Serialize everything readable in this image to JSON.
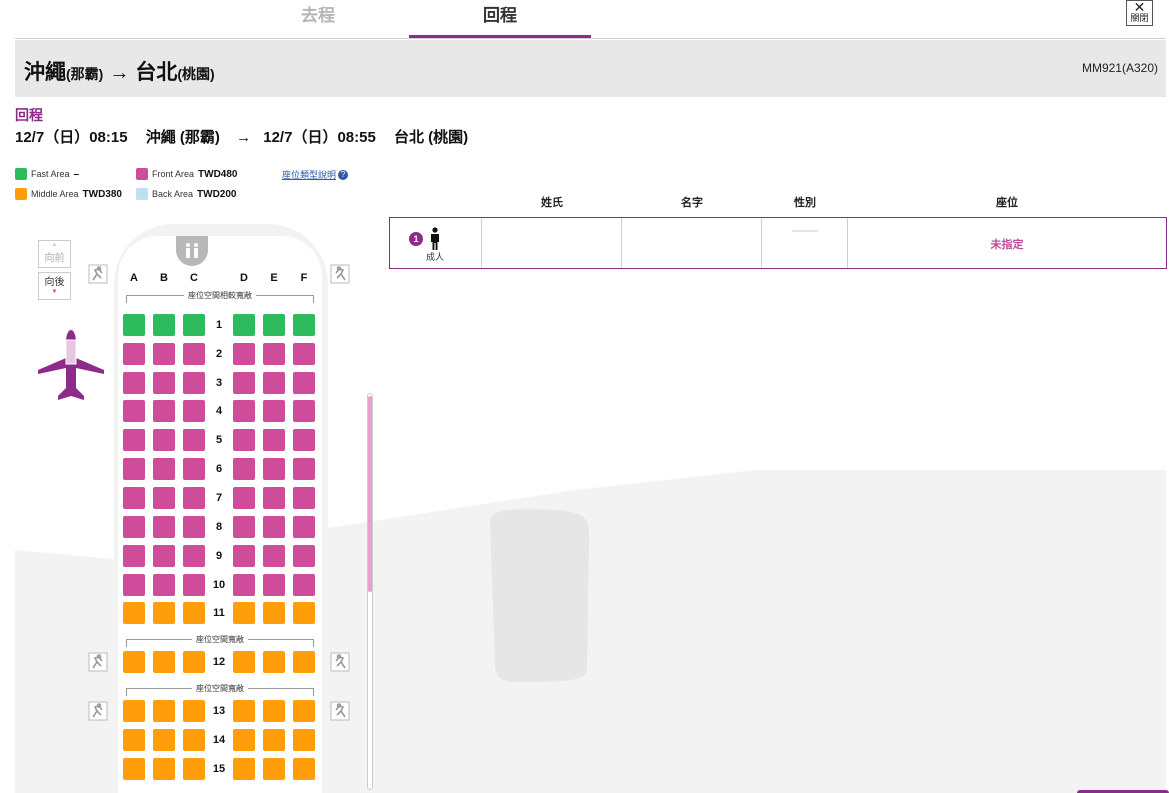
{
  "tabs": {
    "outbound": "去程",
    "return": "回程"
  },
  "close": {
    "label": "關閉"
  },
  "route": {
    "from_city": "沖繩",
    "from_airport": "(那霸)",
    "arrow": "→",
    "to_city": "台北",
    "to_airport": "(桃園)",
    "flight_no": "MM921(A320)"
  },
  "segment": {
    "label": "回程",
    "dep_datetime": "12/7（日）08:15",
    "dep_place": "沖繩 (那霸)",
    "arrow": "→",
    "arr_datetime": "12/7（日）08:55",
    "arr_place": "台北 (桃園)"
  },
  "legend": {
    "fast": {
      "name": "Fast Area",
      "price": "–",
      "color": "#2dbb5e"
    },
    "front": {
      "name": "Front Area",
      "price": "TWD480",
      "color": "#cf4c9a"
    },
    "middle": {
      "name": "Middle Area",
      "price": "TWD380",
      "color": "#ff9d0a"
    },
    "back": {
      "name": "Back Area",
      "price": "TWD200",
      "color": "#bfe0f0"
    },
    "help_link": "座位類型說明"
  },
  "seatmap": {
    "front_label": "向前",
    "back_label": "向後",
    "columns": [
      "A",
      "B",
      "C",
      "D",
      "E",
      "F"
    ],
    "space_note_1": "座位空間相較寬敞",
    "space_note_2": "座位空間寬敞",
    "space_note_3": "座位空間寬敞",
    "rows": [
      {
        "num": "1",
        "area": "fast"
      },
      {
        "num": "2",
        "area": "front"
      },
      {
        "num": "3",
        "area": "front"
      },
      {
        "num": "4",
        "area": "front"
      },
      {
        "num": "5",
        "area": "front"
      },
      {
        "num": "6",
        "area": "front"
      },
      {
        "num": "7",
        "area": "front"
      },
      {
        "num": "8",
        "area": "front"
      },
      {
        "num": "9",
        "area": "front"
      },
      {
        "num": "10",
        "area": "front"
      },
      {
        "num": "11",
        "area": "middle"
      },
      {
        "num": "12",
        "area": "middle"
      },
      {
        "num": "13",
        "area": "middle"
      },
      {
        "num": "14",
        "area": "middle"
      },
      {
        "num": "15",
        "area": "middle"
      }
    ]
  },
  "passenger_table": {
    "headers": {
      "surname": "姓氏",
      "given_name": "名字",
      "gender": "性別",
      "seat": "座位"
    },
    "passengers": [
      {
        "index": "1",
        "type": "成人",
        "surname": "",
        "given_name": "",
        "gender": "",
        "seat": "未指定"
      }
    ]
  }
}
